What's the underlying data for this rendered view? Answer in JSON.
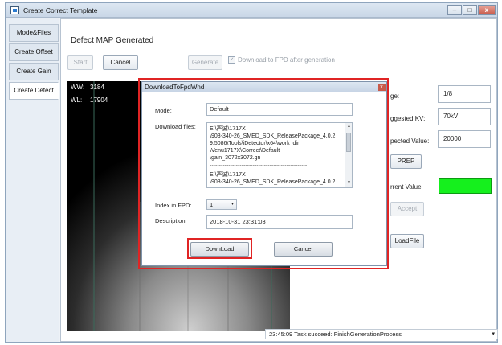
{
  "window": {
    "title": "Create Correct Template",
    "controls": [
      "–",
      "□",
      "x"
    ]
  },
  "side_tabs": [
    "Mode&Files",
    "Create Offset",
    "Create Gain",
    "Create Defect"
  ],
  "main": {
    "heading": "Defect MAP Generated",
    "start_label": "Start",
    "cancel_label": "Cancel",
    "generate_label": "Generate",
    "download_checkbox_label": "Download to FPD after generation",
    "ww_label": "WW:",
    "ww_value": "3184",
    "wl_label": "WL:",
    "wl_value": "17904"
  },
  "right_panel": {
    "partial_label_1": "ge:",
    "value_1": "1/8",
    "partial_label_2": "ggested KV:",
    "value_2": "70kV",
    "partial_label_3": "pected Value:",
    "value_3": "20000",
    "prep_label": "PREP",
    "partial_label_4": "rrent Value:",
    "current_value_color": "#15f01d",
    "accept_label": "Accept",
    "loadfile_label": "LoadFile"
  },
  "status": {
    "text": "23:45:09 Task succeed: FinishGenerationProcess"
  },
  "dialog": {
    "title": "DownloadToFpdWnd",
    "close_label": "x",
    "mode_label": "Mode:",
    "mode_value": "Default",
    "files_label": "Download files:",
    "file_1_lines": [
      "E:\\严诚\\1717X",
      "\\903-340-26_SMED_SDK_ReleasePackage_4.0.2",
      "9.5086\\Tools\\iDetector\\x64\\work_dir",
      "\\Venu1717X\\Correct\\Default",
      "\\gain_3072x3072.gn"
    ],
    "separator": "----------------------------------------------------",
    "file_2_lines": [
      "E:\\严诚\\1717X",
      "\\903-340-26_SMED_SDK_ReleasePackage_4.0.2"
    ],
    "index_label": "Index in FPD:",
    "index_value": "1",
    "description_label": "Description:",
    "description_value": "2018-10-31 23:31:03",
    "download_label": "DownLoad",
    "cancel_label": "Cancel"
  },
  "colors": {
    "highlight_red": "#e02424",
    "image_bg": "#000000"
  }
}
